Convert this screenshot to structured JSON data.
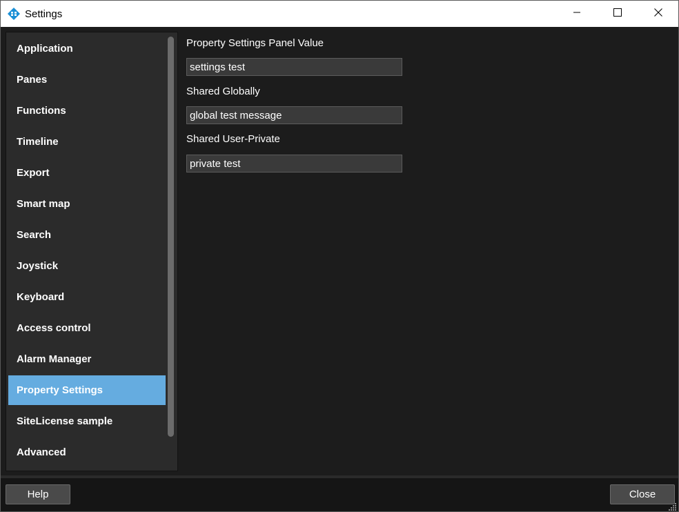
{
  "window": {
    "title": "Settings",
    "icon": "diamond-app-icon",
    "controls": [
      "minimize-icon",
      "maximize-icon",
      "close-icon"
    ]
  },
  "sidebar": {
    "selected_index": 11,
    "items": [
      {
        "label": "Application"
      },
      {
        "label": "Panes"
      },
      {
        "label": "Functions"
      },
      {
        "label": "Timeline"
      },
      {
        "label": "Export"
      },
      {
        "label": "Smart map"
      },
      {
        "label": "Search"
      },
      {
        "label": "Joystick"
      },
      {
        "label": "Keyboard"
      },
      {
        "label": "Access control"
      },
      {
        "label": "Alarm Manager"
      },
      {
        "label": "Property Settings"
      },
      {
        "label": "SiteLicense sample"
      },
      {
        "label": "Advanced"
      }
    ]
  },
  "content": {
    "fields": [
      {
        "label": "Property Settings Panel Value",
        "value": "settings test"
      },
      {
        "label": "Shared Globally",
        "value": "global test message"
      },
      {
        "label": "Shared User-Private",
        "value": "private test"
      }
    ]
  },
  "footer": {
    "help_label": "Help",
    "close_label": "Close"
  },
  "colors": {
    "selected": "#65ace0",
    "background": "#1c1c1c",
    "sidebar": "#2b2b2b",
    "app_icon": "#1a8fd6"
  }
}
